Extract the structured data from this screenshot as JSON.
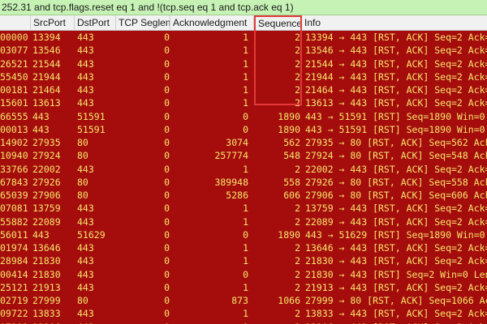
{
  "filter": {
    "text": "252.31 and tcp.flags.reset eq 1 and !(tcp.seq eq 1 and tcp.ack eq 1)"
  },
  "columns": [
    {
      "key": "no",
      "label": ""
    },
    {
      "key": "src",
      "label": "SrcPort"
    },
    {
      "key": "dst",
      "label": "DstPort"
    },
    {
      "key": "seg",
      "label": "TCP Seglen"
    },
    {
      "key": "ack",
      "label": "Acknowledgment"
    },
    {
      "key": "seq",
      "label": "Sequence"
    },
    {
      "key": "info",
      "label": "Info"
    }
  ],
  "rows": [
    {
      "no": "00000",
      "src": "13394",
      "dst": "443",
      "seg": "0",
      "ack": "1",
      "seq": "2",
      "info": "13394 → 443 [RST, ACK] Seq=2 Ack="
    },
    {
      "no": "03077",
      "src": "13546",
      "dst": "443",
      "seg": "0",
      "ack": "1",
      "seq": "2",
      "info": "13546 → 443 [RST, ACK] Seq=2 Ack="
    },
    {
      "no": "26521",
      "src": "21544",
      "dst": "443",
      "seg": "0",
      "ack": "1",
      "seq": "2",
      "info": "21544 → 443 [RST, ACK] Seq=2 Ack="
    },
    {
      "no": "55450",
      "src": "21944",
      "dst": "443",
      "seg": "0",
      "ack": "1",
      "seq": "2",
      "info": "21944 → 443 [RST, ACK] Seq=2 Ack="
    },
    {
      "no": "00181",
      "src": "21464",
      "dst": "443",
      "seg": "0",
      "ack": "1",
      "seq": "2",
      "info": "21464 → 443 [RST, ACK] Seq=2 Ack="
    },
    {
      "no": "15601",
      "src": "13613",
      "dst": "443",
      "seg": "0",
      "ack": "1",
      "seq": "2",
      "info": "13613 → 443 [RST, ACK] Seq=2 Ack="
    },
    {
      "no": "66555",
      "src": "443",
      "dst": "51591",
      "seg": "0",
      "ack": "0",
      "seq": "1890",
      "info": "443 → 51591 [RST] Seq=1890 Win=0"
    },
    {
      "no": "00013",
      "src": "443",
      "dst": "51591",
      "seg": "0",
      "ack": "0",
      "seq": "1890",
      "info": "443 → 51591 [RST] Seq=1890 Win=0"
    },
    {
      "no": "14902",
      "src": "27935",
      "dst": "80",
      "seg": "0",
      "ack": "3074",
      "seq": "562",
      "info": "27935 → 80 [RST, ACK] Seq=562 Ack"
    },
    {
      "no": "10940",
      "src": "27924",
      "dst": "80",
      "seg": "0",
      "ack": "257774",
      "seq": "548",
      "info": "27924 → 80 [RST, ACK] Seq=548 Ack"
    },
    {
      "no": "33766",
      "src": "22002",
      "dst": "443",
      "seg": "0",
      "ack": "1",
      "seq": "2",
      "info": "22002 → 443 [RST, ACK] Seq=2 Ack="
    },
    {
      "no": "67843",
      "src": "27926",
      "dst": "80",
      "seg": "0",
      "ack": "389948",
      "seq": "558",
      "info": "27926 → 80 [RST, ACK] Seq=558 Ack"
    },
    {
      "no": "65039",
      "src": "27906",
      "dst": "80",
      "seg": "0",
      "ack": "5286",
      "seq": "606",
      "info": "27906 → 80 [RST, ACK] Seq=606 Ack"
    },
    {
      "no": "07081",
      "src": "13759",
      "dst": "443",
      "seg": "0",
      "ack": "1",
      "seq": "2",
      "info": "13759 → 443 [RST, ACK] Seq=2 Ack="
    },
    {
      "no": "55882",
      "src": "22089",
      "dst": "443",
      "seg": "0",
      "ack": "1",
      "seq": "2",
      "info": "22089 → 443 [RST, ACK] Seq=2 Ack="
    },
    {
      "no": "56011",
      "src": "443",
      "dst": "51629",
      "seg": "0",
      "ack": "0",
      "seq": "1890",
      "info": "443 → 51629 [RST] Seq=1890 Win=0"
    },
    {
      "no": "01974",
      "src": "13646",
      "dst": "443",
      "seg": "0",
      "ack": "1",
      "seq": "2",
      "info": "13646 → 443 [RST, ACK] Seq=2 Ack="
    },
    {
      "no": "28984",
      "src": "21830",
      "dst": "443",
      "seg": "0",
      "ack": "1",
      "seq": "2",
      "info": "21830 → 443 [RST, ACK] Seq=2 Ack="
    },
    {
      "no": "00414",
      "src": "21830",
      "dst": "443",
      "seg": "0",
      "ack": "0",
      "seq": "2",
      "info": "21830 → 443 [RST] Seq=2 Win=0 Len"
    },
    {
      "no": "25121",
      "src": "21913",
      "dst": "443",
      "seg": "0",
      "ack": "1",
      "seq": "2",
      "info": "21913 → 443 [RST, ACK] Seq=2 Ack="
    },
    {
      "no": "02719",
      "src": "27999",
      "dst": "80",
      "seg": "0",
      "ack": "873",
      "seq": "1066",
      "info": "27999 → 80 [RST, ACK] Seq=1066 Ac"
    },
    {
      "no": "09722",
      "src": "13833",
      "dst": "443",
      "seg": "0",
      "ack": "1",
      "seq": "2",
      "info": "13833 → 443 [RST, ACK] Seq=2 Ack="
    },
    {
      "no": "07392",
      "src": "22106",
      "dst": "443",
      "seg": "0",
      "ack": "1",
      "seq": "2",
      "info": "22106 → 443 [RST, ACK] Seq=2 Ack="
    }
  ],
  "colors": {
    "row_background": "#a50d0d",
    "row_text": "#f6e66a",
    "filter_background": "#c7f2b5",
    "highlight_box": "#e23a3a"
  }
}
